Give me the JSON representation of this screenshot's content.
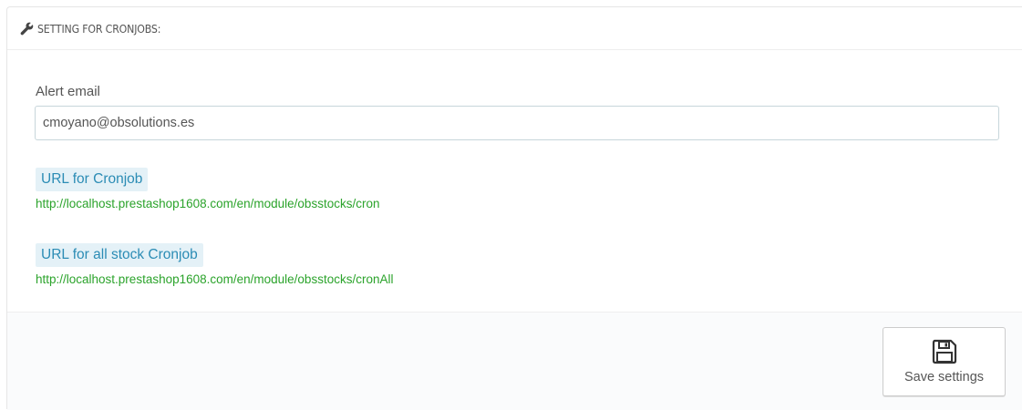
{
  "panel": {
    "heading": "SETTING FOR CRONJOBS:",
    "heading_icon": "wrench-icon"
  },
  "form": {
    "alert_email_label": "Alert email",
    "alert_email_value": "cmoyano@obsolutions.es"
  },
  "cron": {
    "url_label": "URL for Cronjob",
    "url_value": "http://localhost.prestashop1608.com/en/module/obsstocks/cron",
    "all_url_label": "URL for all stock Cronjob",
    "all_url_value": "http://localhost.prestashop1608.com/en/module/obsstocks/cronAll"
  },
  "footer": {
    "save_label": "Save settings",
    "save_icon": "floppy-disk-icon"
  },
  "colors": {
    "label_bg": "#e4f1f7",
    "label_text": "#2b8cb5",
    "url_text": "#2ba32b"
  }
}
